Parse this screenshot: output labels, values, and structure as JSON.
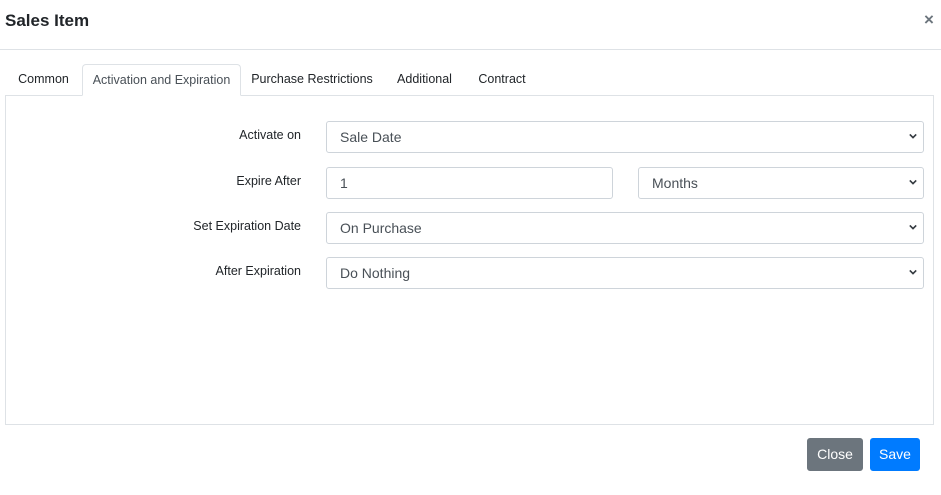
{
  "modal": {
    "title": "Sales Item"
  },
  "tabs": [
    {
      "label": "Common"
    },
    {
      "label": "Activation and Expiration",
      "active": true
    },
    {
      "label": "Purchase Restrictions"
    },
    {
      "label": "Additional"
    },
    {
      "label": "Contract"
    }
  ],
  "form": {
    "activate_on": {
      "label": "Activate on",
      "value": "Sale Date"
    },
    "expire_after": {
      "label": "Expire After",
      "amount": "1",
      "unit": "Months"
    },
    "set_expiration_date": {
      "label": "Set Expiration Date",
      "value": "On Purchase"
    },
    "after_expiration": {
      "label": "After Expiration",
      "value": "Do Nothing"
    }
  },
  "footer": {
    "close_label": "Close",
    "save_label": "Save"
  },
  "icons": {
    "close": "close-icon",
    "select_arrow": "chevron-down-icon"
  },
  "colors": {
    "primary": "#007bff",
    "secondary": "#6c757d",
    "border": "#dee2e6"
  }
}
